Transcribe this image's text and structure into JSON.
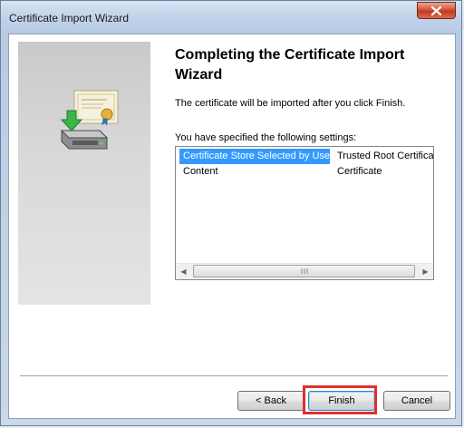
{
  "window": {
    "title": "Certificate Import Wizard",
    "close_icon": "close-icon"
  },
  "wizard": {
    "heading": "Completing the Certificate Import Wizard",
    "info": "The certificate will be imported after you click Finish.",
    "settings_label": "You have specified the following settings:",
    "side_icon": "certificate-import-icon"
  },
  "settings": {
    "rows": [
      {
        "name": "Certificate Store Selected by User",
        "value": "Trusted Root Certifica",
        "selected": true
      },
      {
        "name": "Content",
        "value": "Certificate",
        "selected": false
      }
    ]
  },
  "buttons": {
    "back": "< Back",
    "finish": "Finish",
    "cancel": "Cancel"
  },
  "colors": {
    "selection": "#3399ff",
    "highlight_box": "#e0302c",
    "close_button": "#c23a22"
  }
}
